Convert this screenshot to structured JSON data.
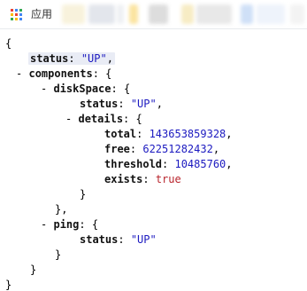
{
  "bookmarks_bar": {
    "apps_label": "应用",
    "bookmark_colors": [
      "#f8f2dc",
      "#e3e6ec",
      "#eef0f3",
      "#fbe4a0",
      "#dddddd",
      "#f7ecc4",
      "#e8e8e8",
      "#cfe0f7",
      "#eef3fb",
      "#f3f3f3"
    ]
  },
  "json_view": {
    "open_brace": "{",
    "close_brace": "}",
    "status_key": "status",
    "status_value": "\"UP\"",
    "components_key": "components",
    "diskspace_key": "diskSpace",
    "diskspace_status_key": "status",
    "diskspace_status_value": "\"UP\"",
    "details_key": "details",
    "total_key": "total",
    "total_value": "143653859328",
    "free_key": "free",
    "free_value": "62251282432",
    "threshold_key": "threshold",
    "threshold_value": "10485760",
    "exists_key": "exists",
    "exists_value": "true",
    "ping_key": "ping",
    "ping_status_key": "status",
    "ping_status_value": "\"UP\"",
    "collapse_toggle": "-",
    "colon": ": ",
    "comma": ",",
    "obj_open": "{",
    "obj_close": "}",
    "obj_close_comma": "},"
  }
}
